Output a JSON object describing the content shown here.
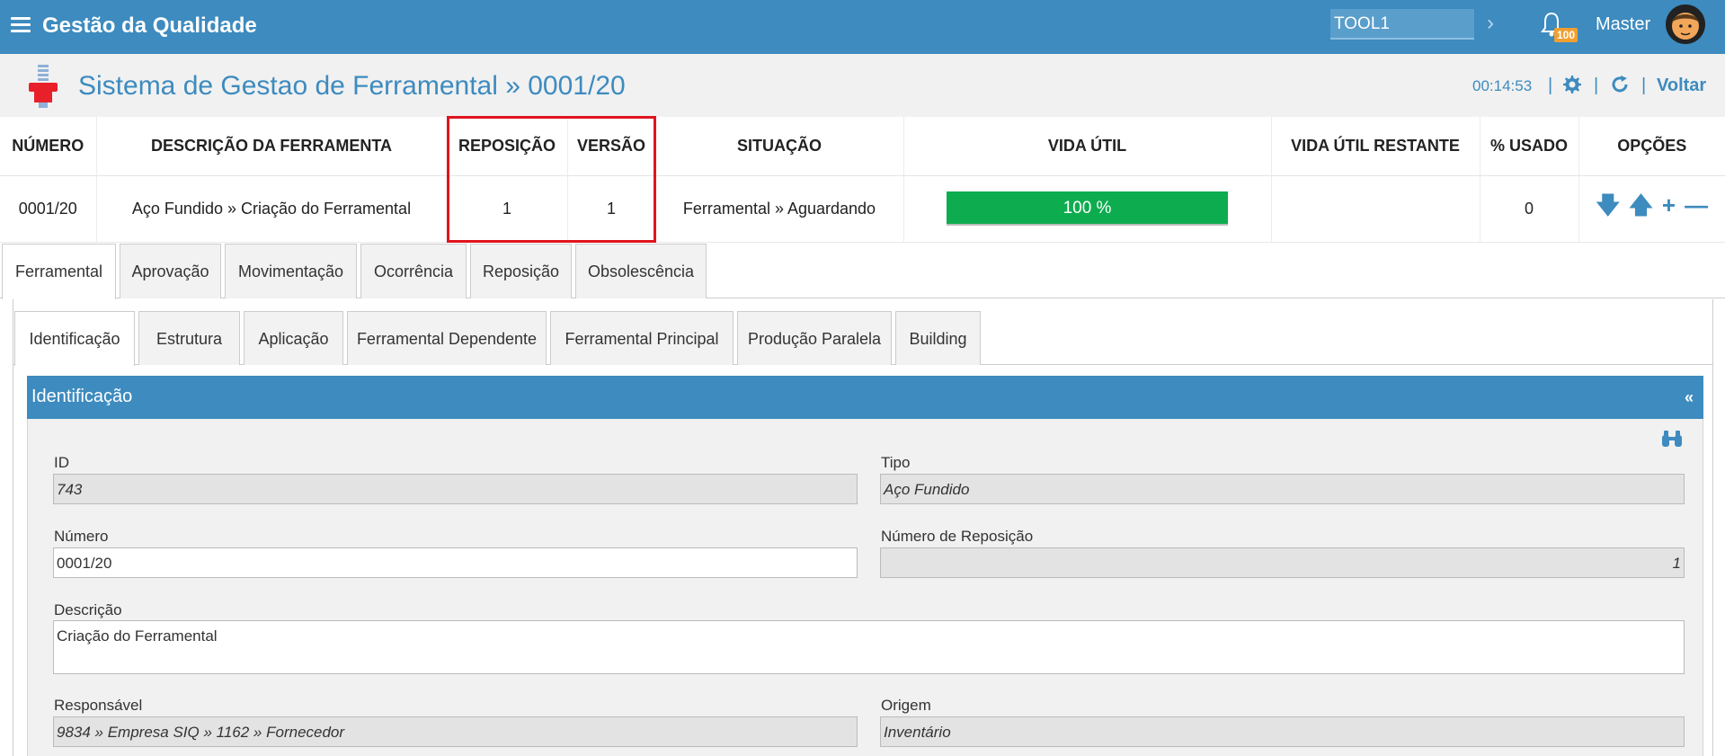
{
  "app": {
    "title": "Gestão da Qualidade",
    "module": "TOOL1",
    "notifications": "100",
    "user": "Master"
  },
  "page": {
    "title": "Sistema de Gestao de Ferramental » 0001/20",
    "time": "00:14:53",
    "back": "Voltar"
  },
  "summary": {
    "headers": [
      "NÚMERO",
      "DESCRIÇÃO DA FERRAMENTA",
      "REPOSIÇÃO",
      "VERSÃO",
      "SITUAÇÃO",
      "VIDA ÚTIL",
      "VIDA ÚTIL RESTANTE",
      "% USADO",
      "OPÇÕES"
    ],
    "row": {
      "numero": "0001/20",
      "descricao": "Aço Fundido » Criação do Ferramental",
      "reposicao": "1",
      "versao": "1",
      "situacao": "Ferramental » Aguardando",
      "vida_util": "100 %",
      "vida_util_restante": "",
      "usado": "0"
    }
  },
  "tabs": [
    "Ferramental",
    "Aprovação",
    "Movimentação",
    "Ocorrência",
    "Reposição",
    "Obsolescência"
  ],
  "subtabs": [
    "Identificação",
    "Estrutura",
    "Aplicação",
    "Ferramental Dependente",
    "Ferramental Principal",
    "Produção Paralela",
    "Building"
  ],
  "section": {
    "title": "Identificação",
    "collapse": "«",
    "fields": {
      "id_label": "ID",
      "id_value": "743",
      "tipo_label": "Tipo",
      "tipo_value": "Aço Fundido",
      "numero_label": "Número",
      "numero_value": "0001/20",
      "numrep_label": "Número de Reposição",
      "numrep_value": "1",
      "descricao_label": "Descrição",
      "descricao_value": "Criação do Ferramental",
      "responsavel_label": "Responsável",
      "responsavel_value": "9834 » Empresa SIQ » 1162 » Fornecedor",
      "origem_label": "Origem",
      "origem_value": "Inventário"
    }
  },
  "colors": {
    "primary": "#3d8bbf",
    "success": "#0dac4f",
    "highlight": "#e0141e",
    "badge": "#f0a030"
  }
}
